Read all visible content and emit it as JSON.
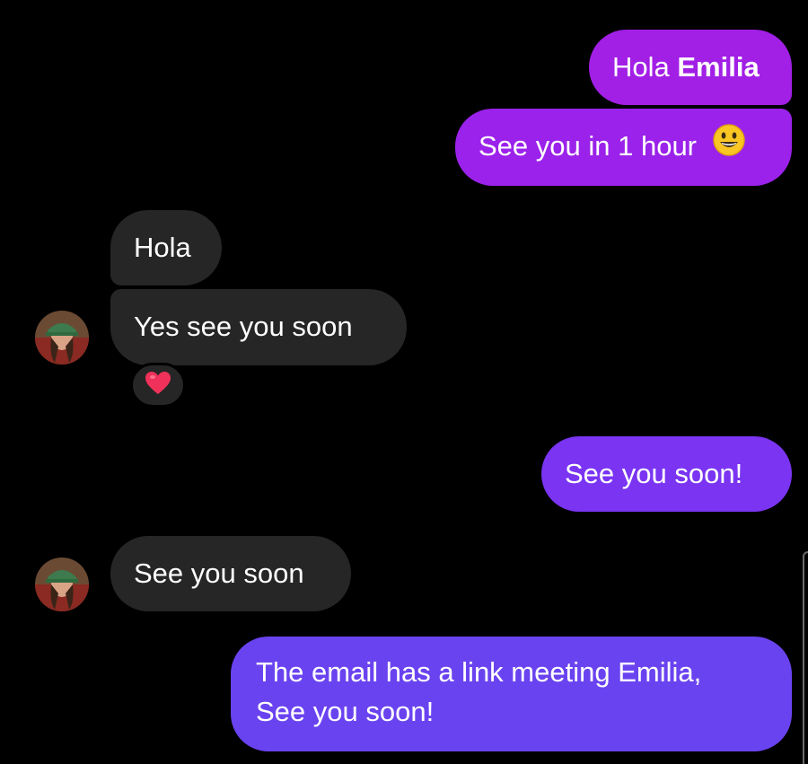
{
  "colors": {
    "background": "#000000",
    "sent_top": "#a21fe6",
    "sent_mid": "#7a34f2",
    "sent_bottom": "#6a43f0",
    "received": "#262626",
    "heart": "#f0325a"
  },
  "messages": [
    {
      "side": "sent",
      "parts": [
        "Hola ",
        "Emilia"
      ]
    },
    {
      "side": "sent",
      "text": "See you in 1 hour",
      "emoji": "smiling-face-icon"
    },
    {
      "side": "received",
      "text": "Hola"
    },
    {
      "side": "received",
      "text": "Yes see you soon",
      "reaction": "heart-icon"
    },
    {
      "side": "sent",
      "text": "See you soon!"
    },
    {
      "side": "received",
      "text": "See you soon"
    },
    {
      "side": "sent",
      "lines": [
        "The email has a link meeting Emilia,",
        "See you soon!"
      ]
    }
  ]
}
